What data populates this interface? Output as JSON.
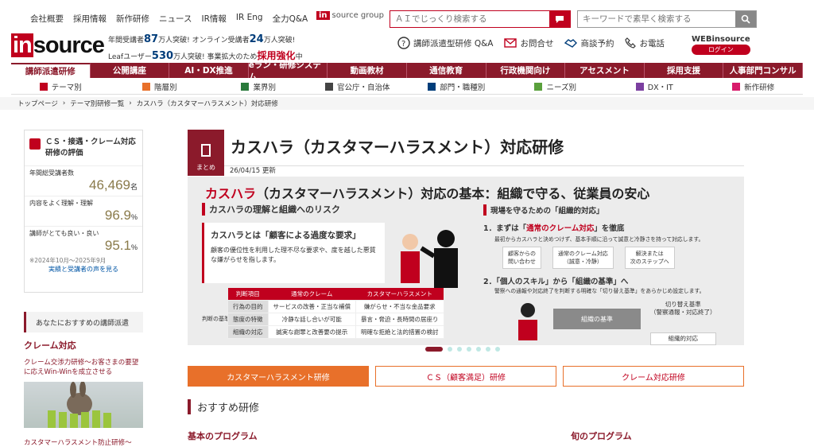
{
  "header": {
    "toplinks": [
      "会社概要",
      "採用情報",
      "新作研修",
      "ニュース",
      "IR情報",
      "IR Eng",
      "全力Q&A"
    ],
    "group_mini": "in",
    "group_label": "source group",
    "ai_search_placeholder": "ＡＩでじっくり検索する",
    "kw_search_placeholder": "キーワードで素早く検索する",
    "logo_in": "in",
    "logo_rest": "source",
    "stats": {
      "l1_a": "年間受講者",
      "l1_n": "87",
      "l1_b": "万人突破!",
      "l1_c": "オンライン受講者",
      "l1_n2": "24",
      "l1_d": "万人突破!",
      "l2_a": "Leafユーザー",
      "l2_n": "530",
      "l2_b": "万人突破!",
      "l2_c": "事業拡大のため",
      "l2_r": "採用強化",
      "l2_d": "中"
    },
    "actions": [
      "講師派遣型研修 Q&A",
      "お問合せ",
      "商談予約",
      "お電話"
    ],
    "web_logo": "WEBinsource",
    "login": "ログイン"
  },
  "nav": [
    "講師派遣研修",
    "公開講座",
    "AI・DX推進",
    "eラン・研修システム",
    "動画教材",
    "通信教育",
    "行政機関向け",
    "アセスメント",
    "採用支援",
    "人事部門コンサル"
  ],
  "subnav": [
    "テーマ別",
    "階層別",
    "業界別",
    "官公庁・自治体",
    "部門・職種別",
    "ニーズ別",
    "DX・IT",
    "新作研修"
  ],
  "subnav_colors": [
    "#c0001e",
    "#e8702a",
    "#2a7a3b",
    "#444",
    "#003d7a",
    "#5aa03c",
    "#7b3fa0",
    "#d81b6b"
  ],
  "breadcrumb": [
    "トップページ",
    "テーマ別研修一覧",
    "カスハラ（カスタマーハラスメント）対応研修"
  ],
  "sidebar": {
    "eval_title": "ＣＳ・接遇・クレーム対応研修の評価",
    "r1_label": "年間総受講者数",
    "r1_val": "46,469",
    "r1_unit": "名",
    "r2_label": "内容をよく理解・理解",
    "r2_val": "96.9",
    "r2_unit": "%",
    "r3_label": "講師がとても良い・良い",
    "r3_val": "95.1",
    "r3_unit": "%",
    "note": "※2024年10月～2025年9月",
    "voice_link": "実績と受講者の声を見る",
    "rec_head": "あなたにおすすめの講師派遣",
    "rec_cat": "クレーム対応",
    "rec_txt1": "クレーム交渉力研修～お客さまの要望に応えWin-Winを成立させる",
    "rec_txt2": "カスタマーハラスメント防止研修～"
  },
  "main": {
    "tag": "まとめ",
    "title": "カスハラ（カスタマーハラスメント）対応研修",
    "updated": "26/04/15 更新",
    "banner": {
      "t_red": "カスハラ",
      "t_rest": "（カスタマーハラスメント）対応の基本：組織で守る、従業員の安心",
      "left_head": "カスハラの理解と組織へのリスク",
      "card_title": "カスハラとは「顧客による過度な要求」",
      "card_desc": "顧客の優位性を利用した理不尽な要求や、度を越した悪質な嫌がらせを指します。",
      "th": [
        "判断項目",
        "通常のクレーム",
        "カスタマーハラスメント"
      ],
      "rows": [
        [
          "行為の目的",
          "サービスの改善・正当な補償",
          "嫌がらせ・不当な金品要求"
        ],
        [
          "態度の特徴",
          "冷静な話し合いが可能",
          "暴言・脅迫・長時間の居座り"
        ],
        [
          "組織の対応",
          "誠実な謝罪と改善要の提示",
          "明確な拒絶と法的措置の検討"
        ]
      ],
      "tbl_side": "判断の基準",
      "right_head": "現場を守るための「組織的対応」",
      "s1_a": "1．まずは「",
      "s1_o": "通常のクレーム対応",
      "s1_b": "」を徹底",
      "s1_desc": "最初からカスハラと決めつけず、基本手順に沿って誠意と冷静さを持って対応します。",
      "boxes": [
        "顧客からの\n問い合わせ",
        "通常のクレーム対応\n（誠意・冷静）",
        "解決または\n次のステップへ"
      ],
      "s2": "2．「個人のスキル」から「組織の基準」へ",
      "s2_desc": "警察への通報や対応終了を判断する明確な「切り替え基準」をあらかじめ設定します。",
      "arrow": "組織の基準",
      "rb_title": "切り替え基準\n（警察通報・対応終了）",
      "rb_box": "組織的対応"
    },
    "tabs": [
      "カスタマーハラスメント研修",
      "ＣＳ（顧客満足）研修",
      "クレーム対応研修"
    ],
    "recom": "おすすめ研修",
    "basic": "基本のプログラム",
    "season": "旬のプログラム"
  }
}
